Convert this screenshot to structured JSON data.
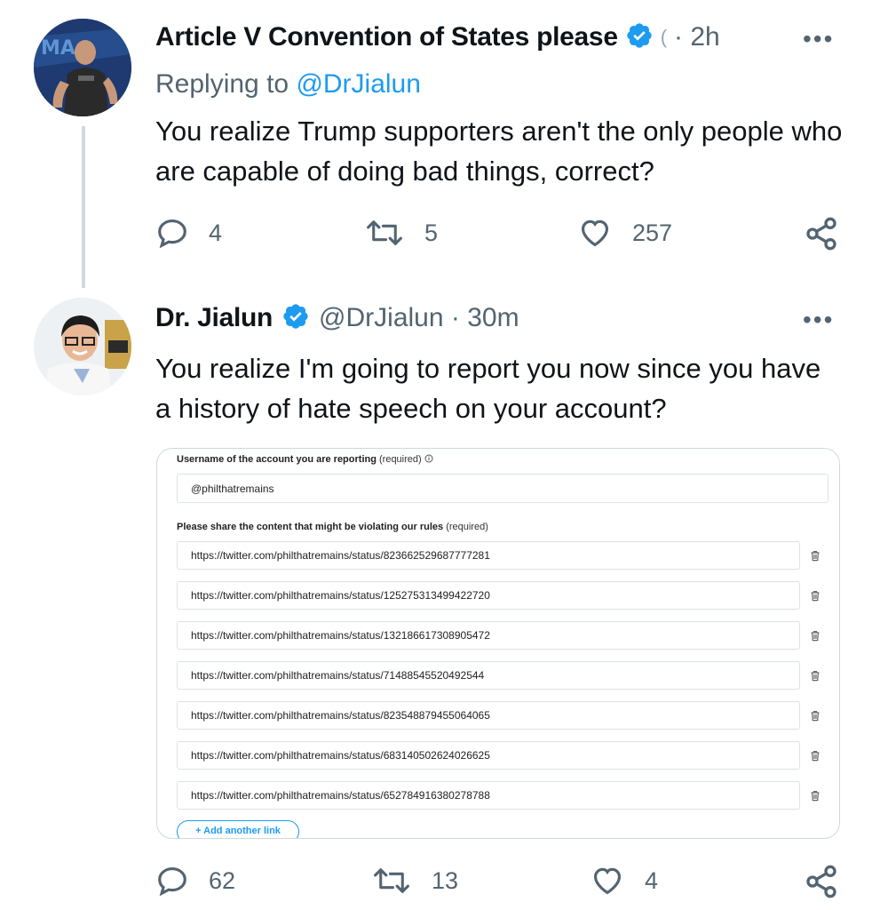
{
  "tweet1": {
    "display_name": "Article V Convention of States please",
    "verified_icon": "verified-badge-icon",
    "time_suffix": "· 2h",
    "time_prefix_glyph": "(",
    "more": "•••",
    "replying_prefix": "Replying to",
    "replying_handle": "@DrJialun",
    "text": "You realize Trump supporters aren't the only people who are capable of doing bad things, correct?",
    "replies": "4",
    "retweets": "5",
    "likes": "257"
  },
  "tweet2": {
    "display_name": "Dr. Jialun",
    "verified_icon": "verified-badge-icon",
    "handle_time": "@DrJialun · 30m",
    "more": "•••",
    "text": "You realize I'm going to report you now since you have a history of hate speech on your account?",
    "replies": "62",
    "retweets": "13",
    "likes": "4"
  },
  "report_form": {
    "username_label": "Username of the account you are reporting",
    "username_required": "(required)",
    "username_info_icon": "info-circle-icon",
    "username_value": "@philthatremains",
    "content_label": "Please share the content that might be violating our rules",
    "content_required": "(required)",
    "links": [
      "https://twitter.com/philthatremains/status/823662529687777281",
      "https://twitter.com/philthatremains/status/125275313499422720",
      "https://twitter.com/philthatremains/status/132186617308905472",
      "https://twitter.com/philthatremains/status/71488545520492544",
      "https://twitter.com/philthatremains/status/823548879455064065",
      "https://twitter.com/philthatremains/status/683140502624026625",
      "https://twitter.com/philthatremains/status/652784916380278788"
    ],
    "add_link_label": "+ Add another link"
  },
  "colors": {
    "accent": "#1d9bf0",
    "secondary_text": "#536471",
    "thread_line": "#cfd9de"
  }
}
